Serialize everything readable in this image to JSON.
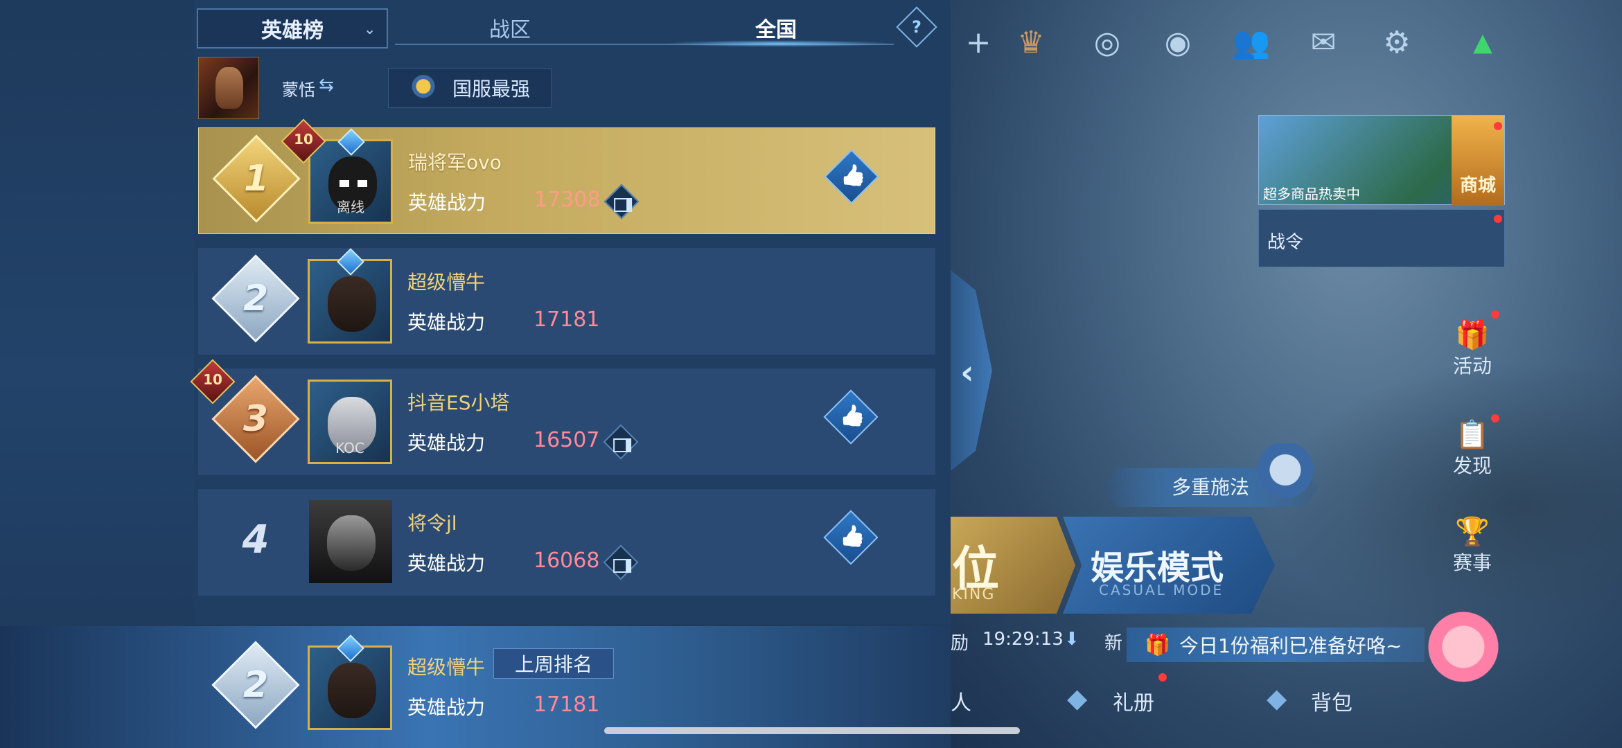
{
  "panel": {
    "dropdown_label": "英雄榜",
    "tabs": [
      {
        "label": "战区",
        "active": false
      },
      {
        "label": "全国",
        "active": true
      }
    ],
    "help_symbol": "?",
    "hero_name": "蒙恬",
    "filter_label": "国服最强"
  },
  "ranking": [
    {
      "rank": "1",
      "name": "瑞将军ovo",
      "power_label": "英雄战力",
      "power": "17308",
      "level": "10",
      "status": "离线",
      "like": true,
      "compare": true
    },
    {
      "rank": "2",
      "name": "超级懵牛",
      "power_label": "英雄战力",
      "power": "17181",
      "level": "",
      "status": "",
      "like": false,
      "compare": false
    },
    {
      "rank": "3",
      "name": "抖音ES小塔",
      "power_label": "英雄战力",
      "power": "16507",
      "level": "10",
      "status": "KOC",
      "like": true,
      "compare": true
    },
    {
      "rank": "4",
      "name": "将令jl",
      "power_label": "英雄战力",
      "power": "16068",
      "level": "",
      "status": "",
      "like": true,
      "compare": true
    }
  ],
  "my_rank": {
    "rank": "2",
    "name": "超级懵牛",
    "tag": "上周排名",
    "power_label": "英雄战力",
    "power": "17181"
  },
  "hud": {
    "shop_caption": "超多商品热卖中",
    "shop_label": "商城",
    "pass_label": "战令",
    "side_items": [
      "活动",
      "发现",
      "赛事"
    ],
    "mode_tag": "多重施法",
    "ranked_big": "位",
    "ranked_small": "KING",
    "casual_big": "娱乐模式",
    "casual_small": "CASUAL MODE",
    "ticker_left": "励",
    "time": "19:29:13",
    "new_label": "新",
    "gift_text": "今日1份福利已准备好咯~",
    "nav_items": [
      "人",
      "礼册",
      "背包"
    ]
  },
  "colors": {
    "panel_bg": "#203e62",
    "gold_row": "#c3aa5e",
    "power_value": "#ff8a9a",
    "name_gold": "#f0d27a"
  }
}
